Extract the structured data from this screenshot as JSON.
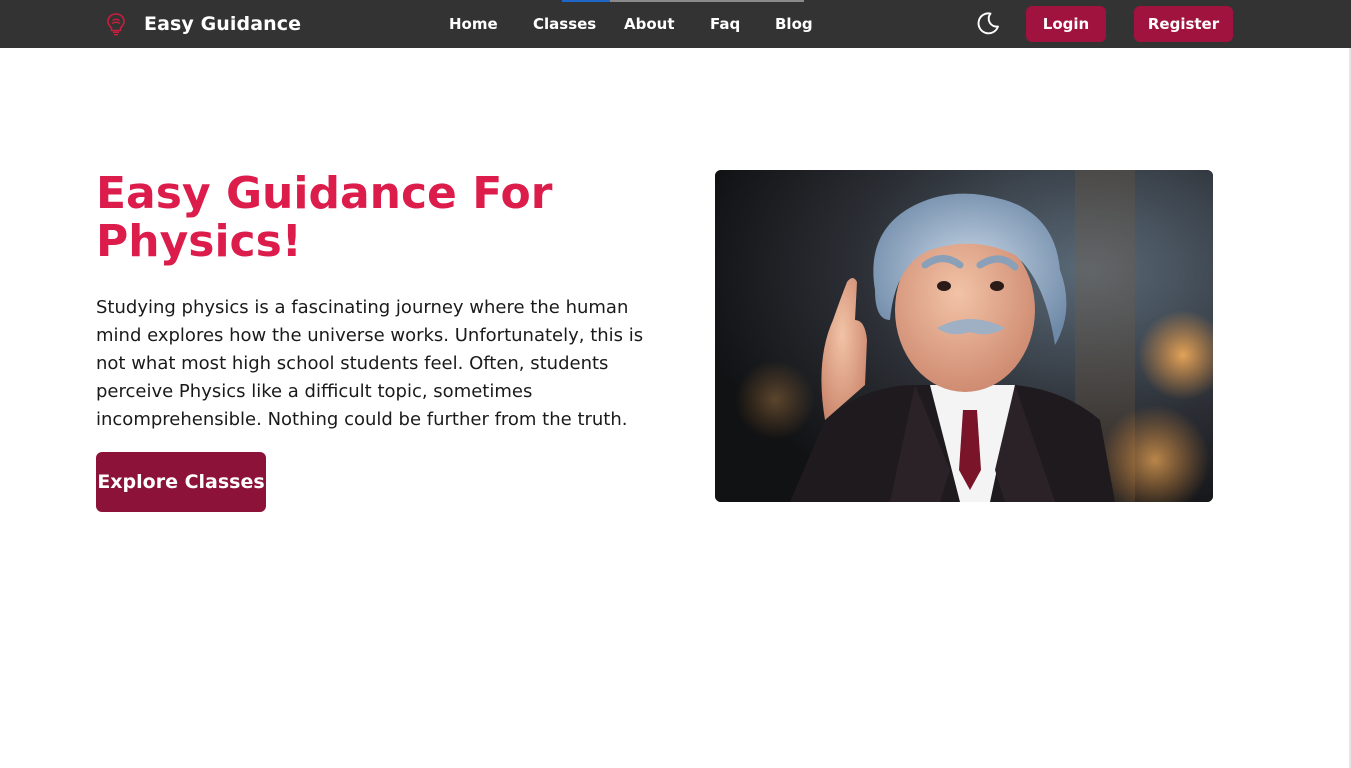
{
  "brand": {
    "name": "Easy Guidance",
    "logo_icon": "lightbulb-logo-icon",
    "accent": "#dc1c4b"
  },
  "nav": {
    "links": [
      {
        "label": "Home"
      },
      {
        "label": "Classes"
      },
      {
        "label": "About"
      },
      {
        "label": "Faq"
      },
      {
        "label": "Blog"
      }
    ],
    "theme_toggle_icon": "moon-icon",
    "login_label": "Login",
    "register_label": "Register",
    "button_color": "#a0133f"
  },
  "hero": {
    "title": "Easy Guidance For Physics!",
    "description": "Studying physics is a fascinating journey where the human mind explores how the universe works. Unfortunately, this is not what most high school students feel. Often, students perceive Physics like a difficult topic, sometimes incomprehensible. Nothing could be further from the truth.",
    "cta_label": "Explore Classes",
    "cta_color": "#8c1239",
    "image_subject": "einstein-figurine-photo"
  }
}
